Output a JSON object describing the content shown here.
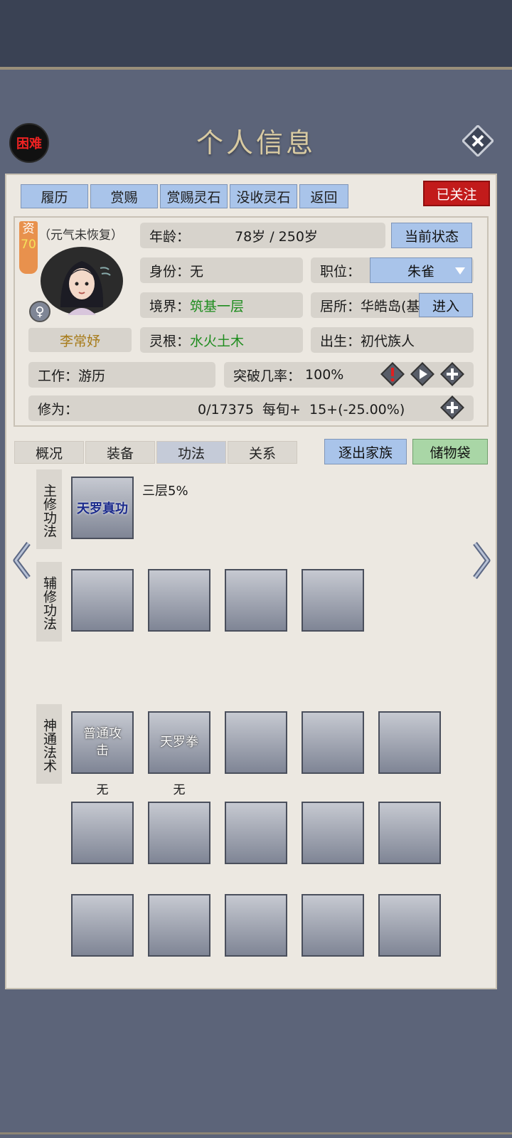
{
  "header": {
    "difficulty": "困难",
    "title": "个人信息"
  },
  "top_buttons": [
    "履历",
    "赏赐",
    "赏赐灵石",
    "没收灵石",
    "返回"
  ],
  "follow_label": "已关注",
  "profile": {
    "aptitude_label": "资",
    "aptitude_value": "70",
    "vital_status": "（元气未恢复）",
    "name": "李常妤",
    "gender_symbol": "♀",
    "age_label": "年龄：",
    "age_value": "78岁 / 250岁",
    "state_button": "当前状态",
    "identity_label": "身份：",
    "identity_value": "无",
    "position_label": "职位：",
    "position_value": "朱雀",
    "realm_label": "境界：",
    "realm_value": "筑基一层",
    "residence_label": "居所：",
    "residence_value": "华皓岛(基",
    "enter_button": "进入",
    "root_label": "灵根：",
    "root_value": "水火土木",
    "birth_label": "出生：",
    "birth_value": "初代族人",
    "job_label": "工作：",
    "job_value": "游历",
    "breakthrough_label": "突破几率：",
    "breakthrough_value": "100%",
    "cultivation_label": "修为：",
    "cultivation_value": "0/17375  每旬+  15+(-25.00%)"
  },
  "tabs": [
    "概况",
    "装备",
    "功法",
    "关系"
  ],
  "action_buttons": {
    "expel": "逐出家族",
    "storage": "储物袋"
  },
  "skills": {
    "main_label": "主修功法",
    "main_slot": "天罗真功",
    "main_level": "三层5%",
    "aux_label": "辅修功法",
    "magic_label": "神通法术",
    "magic_slot1": "普通攻击",
    "magic_slot1_level": "无",
    "magic_slot2": "天罗拳",
    "magic_slot2_level": "无"
  },
  "colors": {
    "accent_blue": "#a9c4ea",
    "follow_red": "#c21b1b",
    "green_text": "#1e8c1e",
    "panel": "#ece8e1"
  }
}
